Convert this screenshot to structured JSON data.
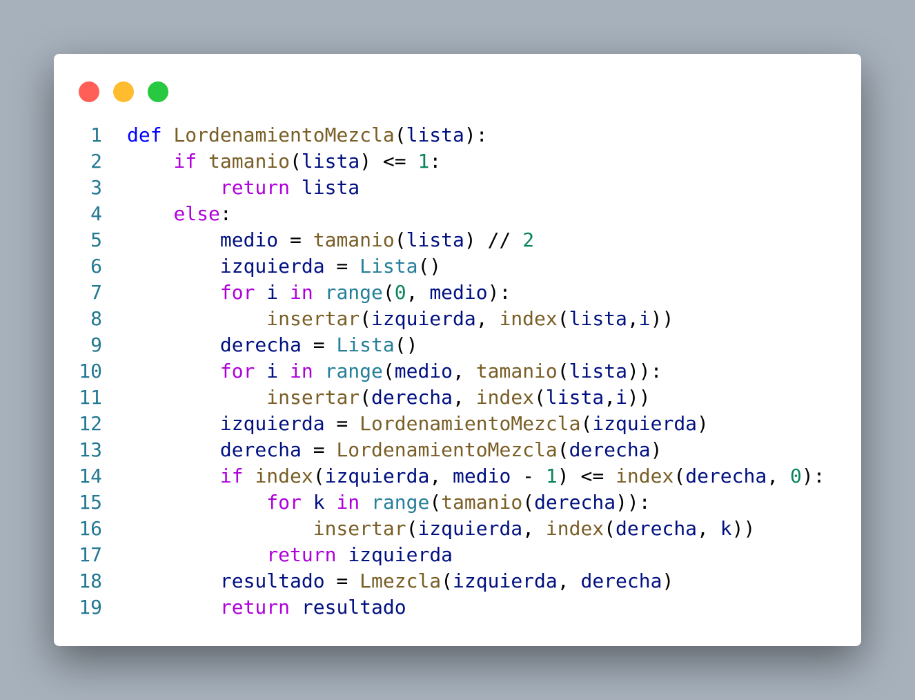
{
  "window": {
    "controls": [
      {
        "name": "close-button",
        "color": "#ff5f57"
      },
      {
        "name": "minimize-button",
        "color": "#febc2e"
      },
      {
        "name": "maximize-button",
        "color": "#28c840"
      }
    ]
  },
  "colors": {
    "background": "#a7b1bc",
    "panel": "#ffffff",
    "line_number": "#237893",
    "def": "#0000ff",
    "keyword": "#af00db",
    "function": "#795e26",
    "variable": "#001080",
    "number": "#098658",
    "builtin": "#267f99",
    "class": "#267f99",
    "punct": "#000000"
  },
  "code": {
    "lines": [
      {
        "n": "1",
        "tokens": [
          [
            "def",
            "def"
          ],
          [
            "p",
            " "
          ],
          [
            "fn",
            "LordenamientoMezcla"
          ],
          [
            "p",
            "("
          ],
          [
            "v",
            "lista"
          ],
          [
            "p",
            "):"
          ]
        ]
      },
      {
        "n": "2",
        "tokens": [
          [
            "p",
            "    "
          ],
          [
            "kw",
            "if"
          ],
          [
            "p",
            " "
          ],
          [
            "fn",
            "tamanio"
          ],
          [
            "p",
            "("
          ],
          [
            "v",
            "lista"
          ],
          [
            "p",
            ") <= "
          ],
          [
            "num",
            "1"
          ],
          [
            "p",
            ":"
          ]
        ]
      },
      {
        "n": "3",
        "tokens": [
          [
            "p",
            "        "
          ],
          [
            "kw",
            "return"
          ],
          [
            "p",
            " "
          ],
          [
            "v",
            "lista"
          ]
        ]
      },
      {
        "n": "4",
        "tokens": [
          [
            "p",
            "    "
          ],
          [
            "kw",
            "else"
          ],
          [
            "p",
            ":"
          ]
        ]
      },
      {
        "n": "5",
        "tokens": [
          [
            "p",
            "        "
          ],
          [
            "v",
            "medio"
          ],
          [
            "p",
            " = "
          ],
          [
            "fn",
            "tamanio"
          ],
          [
            "p",
            "("
          ],
          [
            "v",
            "lista"
          ],
          [
            "p",
            ") // "
          ],
          [
            "num",
            "2"
          ]
        ]
      },
      {
        "n": "6",
        "tokens": [
          [
            "p",
            "        "
          ],
          [
            "v",
            "izquierda"
          ],
          [
            "p",
            " = "
          ],
          [
            "cls",
            "Lista"
          ],
          [
            "p",
            "()"
          ]
        ]
      },
      {
        "n": "7",
        "tokens": [
          [
            "p",
            "        "
          ],
          [
            "kw",
            "for"
          ],
          [
            "p",
            " "
          ],
          [
            "v",
            "i"
          ],
          [
            "p",
            " "
          ],
          [
            "kw",
            "in"
          ],
          [
            "p",
            " "
          ],
          [
            "bi",
            "range"
          ],
          [
            "p",
            "("
          ],
          [
            "num",
            "0"
          ],
          [
            "p",
            ", "
          ],
          [
            "v",
            "medio"
          ],
          [
            "p",
            "):"
          ]
        ]
      },
      {
        "n": "8",
        "tokens": [
          [
            "p",
            "            "
          ],
          [
            "fn",
            "insertar"
          ],
          [
            "p",
            "("
          ],
          [
            "v",
            "izquierda"
          ],
          [
            "p",
            ", "
          ],
          [
            "fn",
            "index"
          ],
          [
            "p",
            "("
          ],
          [
            "v",
            "lista"
          ],
          [
            "p",
            ","
          ],
          [
            "v",
            "i"
          ],
          [
            "p",
            "))"
          ]
        ]
      },
      {
        "n": "9",
        "tokens": [
          [
            "p",
            "        "
          ],
          [
            "v",
            "derecha"
          ],
          [
            "p",
            " = "
          ],
          [
            "cls",
            "Lista"
          ],
          [
            "p",
            "()"
          ]
        ]
      },
      {
        "n": "10",
        "tokens": [
          [
            "p",
            "        "
          ],
          [
            "kw",
            "for"
          ],
          [
            "p",
            " "
          ],
          [
            "v",
            "i"
          ],
          [
            "p",
            " "
          ],
          [
            "kw",
            "in"
          ],
          [
            "p",
            " "
          ],
          [
            "bi",
            "range"
          ],
          [
            "p",
            "("
          ],
          [
            "v",
            "medio"
          ],
          [
            "p",
            ", "
          ],
          [
            "fn",
            "tamanio"
          ],
          [
            "p",
            "("
          ],
          [
            "v",
            "lista"
          ],
          [
            "p",
            ")):"
          ]
        ]
      },
      {
        "n": "11",
        "tokens": [
          [
            "p",
            "            "
          ],
          [
            "fn",
            "insertar"
          ],
          [
            "p",
            "("
          ],
          [
            "v",
            "derecha"
          ],
          [
            "p",
            ", "
          ],
          [
            "fn",
            "index"
          ],
          [
            "p",
            "("
          ],
          [
            "v",
            "lista"
          ],
          [
            "p",
            ","
          ],
          [
            "v",
            "i"
          ],
          [
            "p",
            "))"
          ]
        ]
      },
      {
        "n": "12",
        "tokens": [
          [
            "p",
            "        "
          ],
          [
            "v",
            "izquierda"
          ],
          [
            "p",
            " = "
          ],
          [
            "fn",
            "LordenamientoMezcla"
          ],
          [
            "p",
            "("
          ],
          [
            "v",
            "izquierda"
          ],
          [
            "p",
            ")"
          ]
        ]
      },
      {
        "n": "13",
        "tokens": [
          [
            "p",
            "        "
          ],
          [
            "v",
            "derecha"
          ],
          [
            "p",
            " = "
          ],
          [
            "fn",
            "LordenamientoMezcla"
          ],
          [
            "p",
            "("
          ],
          [
            "v",
            "derecha"
          ],
          [
            "p",
            ")"
          ]
        ]
      },
      {
        "n": "14",
        "tokens": [
          [
            "p",
            "        "
          ],
          [
            "kw",
            "if"
          ],
          [
            "p",
            " "
          ],
          [
            "fn",
            "index"
          ],
          [
            "p",
            "("
          ],
          [
            "v",
            "izquierda"
          ],
          [
            "p",
            ", "
          ],
          [
            "v",
            "medio"
          ],
          [
            "p",
            " - "
          ],
          [
            "num",
            "1"
          ],
          [
            "p",
            ") <= "
          ],
          [
            "fn",
            "index"
          ],
          [
            "p",
            "("
          ],
          [
            "v",
            "derecha"
          ],
          [
            "p",
            ", "
          ],
          [
            "num",
            "0"
          ],
          [
            "p",
            "):"
          ]
        ]
      },
      {
        "n": "15",
        "tokens": [
          [
            "p",
            "            "
          ],
          [
            "kw",
            "for"
          ],
          [
            "p",
            " "
          ],
          [
            "v",
            "k"
          ],
          [
            "p",
            " "
          ],
          [
            "kw",
            "in"
          ],
          [
            "p",
            " "
          ],
          [
            "bi",
            "range"
          ],
          [
            "p",
            "("
          ],
          [
            "fn",
            "tamanio"
          ],
          [
            "p",
            "("
          ],
          [
            "v",
            "derecha"
          ],
          [
            "p",
            ")):"
          ]
        ]
      },
      {
        "n": "16",
        "tokens": [
          [
            "p",
            "                "
          ],
          [
            "fn",
            "insertar"
          ],
          [
            "p",
            "("
          ],
          [
            "v",
            "izquierda"
          ],
          [
            "p",
            ", "
          ],
          [
            "fn",
            "index"
          ],
          [
            "p",
            "("
          ],
          [
            "v",
            "derecha"
          ],
          [
            "p",
            ", "
          ],
          [
            "v",
            "k"
          ],
          [
            "p",
            "))"
          ]
        ]
      },
      {
        "n": "17",
        "tokens": [
          [
            "p",
            "            "
          ],
          [
            "kw",
            "return"
          ],
          [
            "p",
            " "
          ],
          [
            "v",
            "izquierda"
          ]
        ]
      },
      {
        "n": "18",
        "tokens": [
          [
            "p",
            "        "
          ],
          [
            "v",
            "resultado"
          ],
          [
            "p",
            " = "
          ],
          [
            "fn",
            "Lmezcla"
          ],
          [
            "p",
            "("
          ],
          [
            "v",
            "izquierda"
          ],
          [
            "p",
            ", "
          ],
          [
            "v",
            "derecha"
          ],
          [
            "p",
            ")"
          ]
        ]
      },
      {
        "n": "19",
        "tokens": [
          [
            "p",
            "        "
          ],
          [
            "kw",
            "return"
          ],
          [
            "p",
            " "
          ],
          [
            "v",
            "resultado"
          ]
        ]
      }
    ]
  }
}
